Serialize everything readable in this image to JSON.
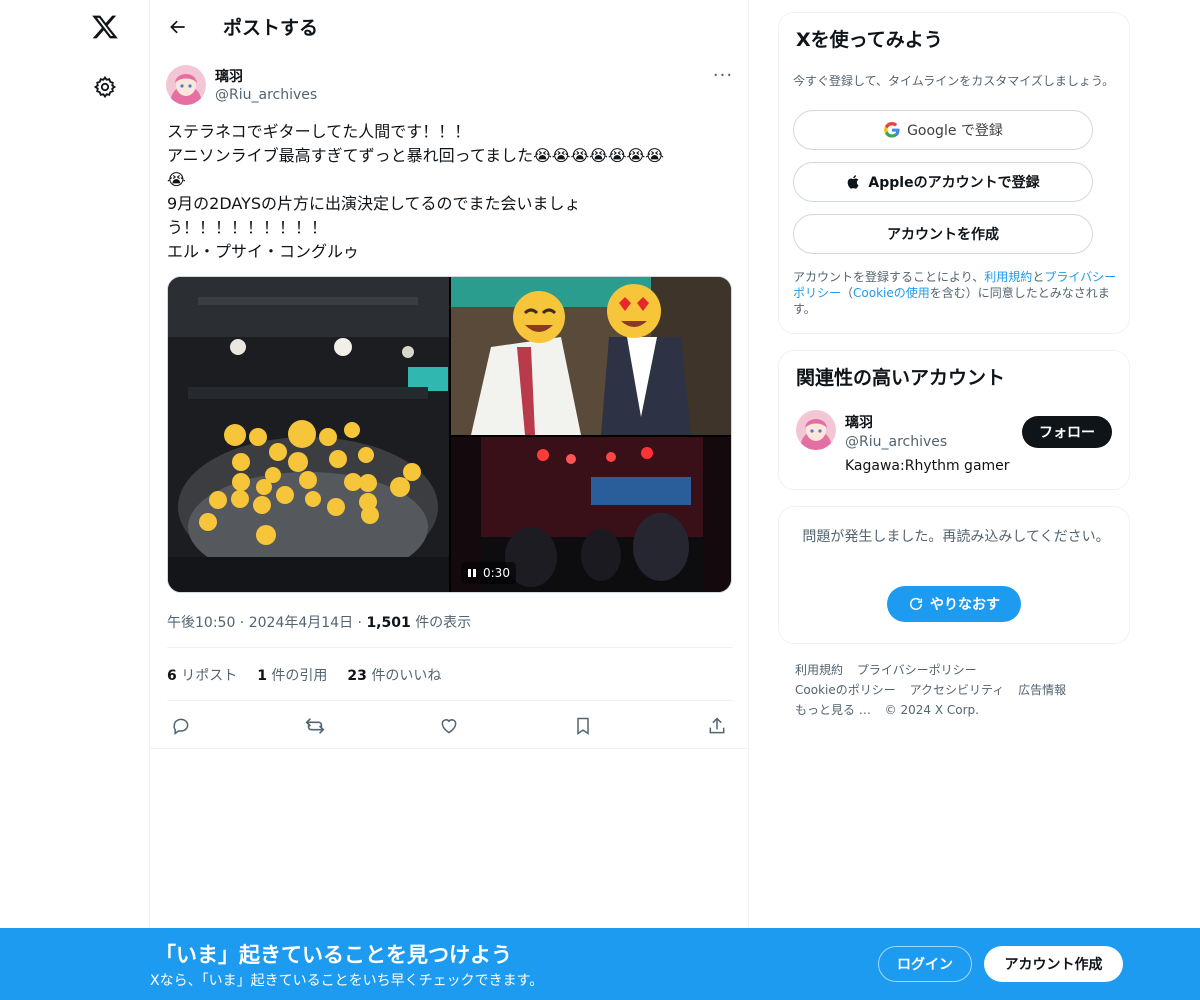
{
  "header": {
    "title": "ポストする"
  },
  "post": {
    "author_name": "璃羽",
    "author_handle": "@Riu_archives",
    "more": "···",
    "text_lines": [
      "ステラネコでギターしてた人間です！！！",
      "アニソンライブ最高すぎてずっと暴れ回ってました😭😭😭😭😭😭😭",
      "😭",
      "9月の2DAYSの片方に出演決定してるのでまた会いましょ",
      "う！！！！！！！！！",
      "エル・プサイ・コングルゥ"
    ],
    "video_duration": "0:30",
    "time": "午後10:50",
    "date": "2024年4月14日",
    "views_count": "1,501",
    "views_label": "件の表示",
    "reposts_count": "6",
    "reposts_label": "リポスト",
    "quotes_count": "1",
    "quotes_label": "件の引用",
    "likes_count": "23",
    "likes_label": "件のいいね"
  },
  "signup": {
    "title": "Xを使ってみよう",
    "subtitle": "今すぐ登録して、タイムラインをカスタマイズしましょう。",
    "google_label": "Google で登録",
    "apple_label": "Appleのアカウントで登録",
    "create_label": "アカウントを作成",
    "terms_pre": "アカウントを登録することにより、",
    "terms_link1": "利用規約",
    "terms_and": "と",
    "terms_link2": "プライバシーポリシー",
    "terms_mid": "（",
    "terms_link3": "Cookieの使用",
    "terms_post": "を含む）に同意したとみなされます。"
  },
  "related": {
    "title": "関連性の高いアカウント",
    "name": "璃羽",
    "handle": "@Riu_archives",
    "bio": "Kagawa:Rhythm gamer",
    "follow_label": "フォロー"
  },
  "error": {
    "message": "問題が発生しました。再読み込みしてください。",
    "retry_label": "やりなおす"
  },
  "footer": {
    "links": [
      "利用規約",
      "プライバシーポリシー",
      "Cookieのポリシー",
      "アクセシビリティ",
      "広告情報",
      "もっと見る …"
    ],
    "copyright": "© 2024 X Corp."
  },
  "banner": {
    "title": "「いま」起きていることを見つけよう",
    "subtitle": "Xなら、「いま」起きていることをいち早くチェックできます。",
    "login_label": "ログイン",
    "create_label": "アカウント作成"
  },
  "colors": {
    "accent": "#1d9bf0",
    "text": "#0f1419",
    "muted": "#536471"
  }
}
